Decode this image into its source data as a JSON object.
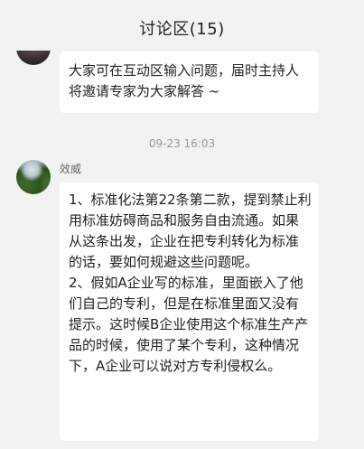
{
  "header": {
    "title": "讨论区(15)"
  },
  "messages": [
    {
      "sender": "",
      "text": "大家可在互动区输入问题，届时主持人将邀请专家为大家解答 ~"
    },
    {
      "timestamp": "09-23 16:03",
      "sender": "效威",
      "text": "1、标准化法第22条第二款，提到禁止利用标准妨碍商品和服务自由流通。如果从这条出发，企业在把专利转化为标准的话，要如何规避这些问题呢。\n2、假如A企业写的标准，里面嵌入了他们自己的专利，但是在标准里面又没有提示。这时候B企业使用这个标准生产产品的时候，使用了某个专利，这种情况下，A企业可以说对方专利侵权么。"
    }
  ],
  "colors": {
    "background": "#f2f2f2",
    "bubble": "#ffffff",
    "text": "#222222",
    "meta": "#999999"
  }
}
